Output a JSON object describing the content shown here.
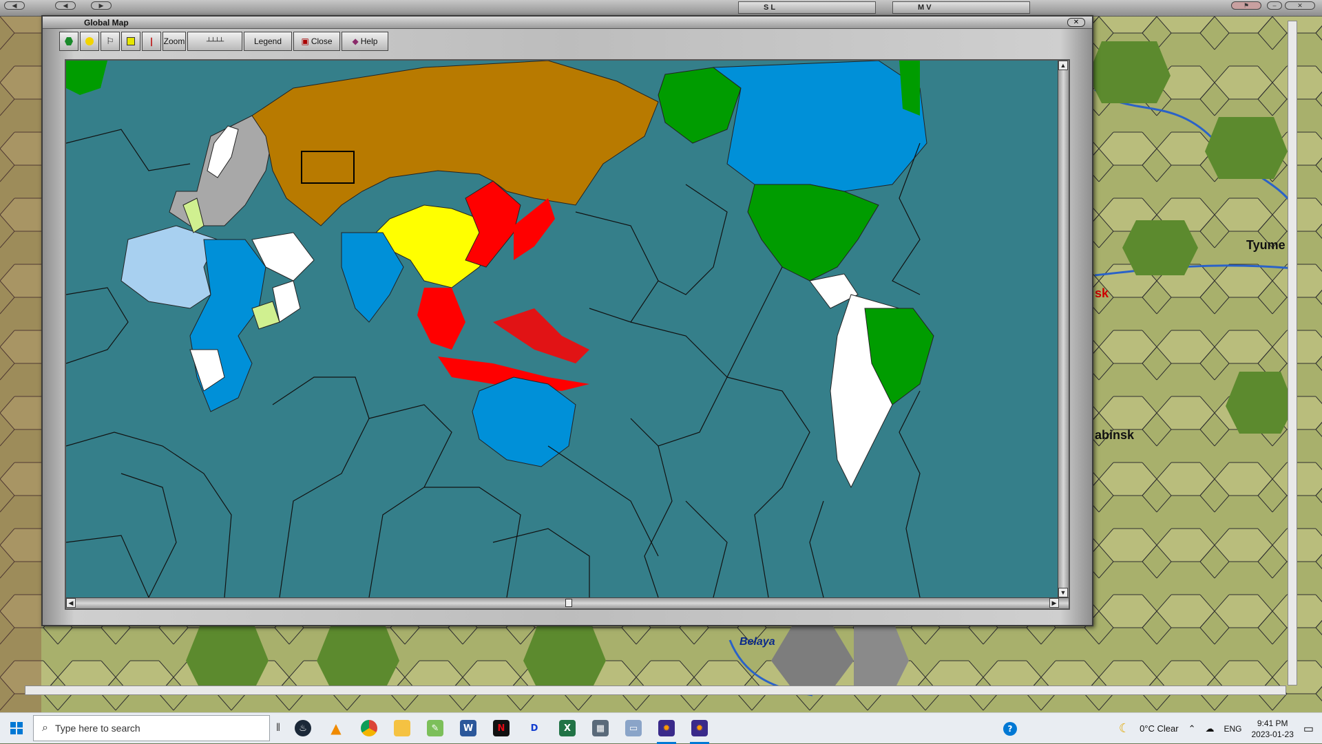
{
  "top_strip": {
    "panel_sl_label": "S L",
    "panel_mv_label": "M V"
  },
  "window": {
    "title": "Global Map",
    "toolbar": {
      "zoom_label": "Zoom",
      "legend_label": "Legend",
      "close_label": "Close",
      "help_label": "Help"
    }
  },
  "background_map": {
    "cities": [
      {
        "name": "Tyume"
      },
      {
        "name": "sk"
      },
      {
        "name": "abinsk"
      },
      {
        "name": "Belaya"
      }
    ]
  },
  "nation_colors": {
    "ussr": "#b87a00",
    "japan": "#ff0000",
    "china": "#ffff00",
    "usa": "#009c00",
    "commonwealth": "#0090d8",
    "axis_europe": "#a8a8a8",
    "neutral": "#ffffff",
    "french": "#a8d0f0",
    "italy": "#d0f090",
    "ocean": "#357f8a"
  },
  "taskbar": {
    "search_placeholder": "Type here to search",
    "weather": "0°C  Clear",
    "language": "ENG",
    "time": "9:41 PM",
    "date": "2023-01-23"
  }
}
